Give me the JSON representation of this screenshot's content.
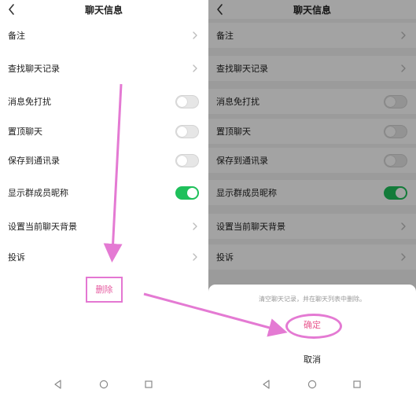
{
  "title": "聊天信息",
  "rows": [
    {
      "label": "备注",
      "kind": "chevron"
    },
    {
      "label": "查找聊天记录",
      "kind": "chevron"
    },
    {
      "label": "消息免打扰",
      "kind": "toggle",
      "on": false
    },
    {
      "label": "置顶聊天",
      "kind": "toggle",
      "on": false
    },
    {
      "label": "保存到通讯录",
      "kind": "toggle",
      "on": false
    },
    {
      "label": "显示群成员昵称",
      "kind": "toggle",
      "on": true
    },
    {
      "label": "设置当前聊天背景",
      "kind": "chevron"
    },
    {
      "label": "投诉",
      "kind": "chevron"
    }
  ],
  "delete_label": "删除",
  "sheet": {
    "message": "清空聊天记录，并在聊天列表中删除。",
    "confirm_label": "确定",
    "cancel_label": "取消"
  },
  "colors": {
    "toggle_on": "#1fc05b",
    "annotation": "#e47ad3",
    "delete_text": "#e65aa0"
  },
  "icons": [
    "back-arrow-icon",
    "chevron-right-icon",
    "nav-back-icon",
    "nav-home-icon",
    "nav-recent-icon"
  ]
}
